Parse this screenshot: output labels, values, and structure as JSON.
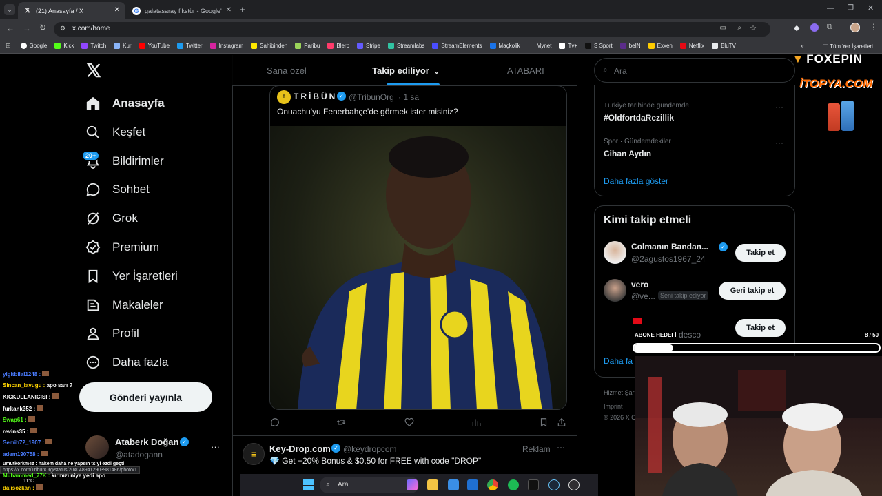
{
  "browser": {
    "tabs": [
      {
        "title": "(21) Anasayfa / X"
      },
      {
        "title": "galatasaray fikstür - Google'da"
      }
    ],
    "url": "x.com/home",
    "bookmarks": [
      "Google",
      "Kick",
      "Twitch",
      "Kur",
      "YouTube",
      "Twitter",
      "Instagram",
      "Sahibinden",
      "Paribu",
      "Blerp",
      "Stripe",
      "Streamlabs",
      "StreamElements",
      "Maçkolik",
      "Mynet",
      "Tv+",
      "S Sport",
      "beIN",
      "Exxen",
      "Netflix",
      "BluTV"
    ],
    "all_bookmarks": "Tüm Yer İşaretleri"
  },
  "nav": {
    "items": [
      {
        "label": "Anasayfa"
      },
      {
        "label": "Keşfet"
      },
      {
        "label": "Bildirimler"
      },
      {
        "label": "Sohbet"
      },
      {
        "label": "Grok"
      },
      {
        "label": "Premium"
      },
      {
        "label": "Yer İşaretleri"
      },
      {
        "label": "Makaleler"
      },
      {
        "label": "Profil"
      },
      {
        "label": "Daha fazla"
      }
    ],
    "notif_badge": "20+",
    "post_button": "Gönderi yayınla",
    "account": {
      "name": "Ataberk Doğan",
      "handle": "@atadogann"
    }
  },
  "feed": {
    "tabs": [
      "Sana özel",
      "Takip ediliyor",
      "ATABARI"
    ],
    "quote": {
      "name": "TRİBÜN",
      "handle": "@TribunOrg",
      "time": "· 1 sa",
      "text": "Onuachu'yu Fenerbahçe'de görmek ister misiniz?"
    },
    "ad": {
      "name": "Key-Drop.com",
      "handle": "@keydropcom",
      "label": "Reklam",
      "text": "💎 Get +20% Bonus & $0.50 for FREE with code \"DROP\""
    }
  },
  "right": {
    "search_placeholder": "Ara",
    "trends": [
      {
        "context": "Türkiye tarihinde gündemde",
        "topic": "#OldfortdaRezillik"
      },
      {
        "context": "Spor · Gündemdekiler",
        "topic": "Cihan Aydın"
      }
    ],
    "show_more": "Daha fazla göster",
    "who_to_follow": {
      "title": "Kimi takip etmeli",
      "users": [
        {
          "name": "Colmanın Bandan...",
          "handle": "@2agustos1967_24",
          "button": "Takip et"
        },
        {
          "name": "vero",
          "handle": "@ve...",
          "badge": "Seni takip ediyor",
          "button": "Geri takip et"
        },
        {
          "name": "",
          "handle": "desco",
          "button": "Takip et"
        }
      ],
      "show_more": "Daha fa"
    },
    "footer": [
      "Hizmet Şar",
      "Imprint",
      "© 2026 X C"
    ]
  },
  "overlay": {
    "sponsors": [
      "FOXEPIN",
      "İTOPYA.COM"
    ],
    "goal_label": "ABONE HEDEFİ",
    "goal_value": "8 / 50",
    "goal_progress": 0.16,
    "status_url": "https://x.com/TribunOrg/status/2040489412903981486/photo/1",
    "weather": "11°C",
    "chat": [
      {
        "user": "yigitbilal1248 :",
        "msg": "",
        "color": "#4a7cff"
      },
      {
        "user": "Sincan_lavugu :",
        "msg": "apo sarı ?",
        "color": "#ffd400"
      },
      {
        "user": "KICKULLANICISI :",
        "msg": "",
        "color": "#ffffff"
      },
      {
        "user": "furkank352 :",
        "msg": "",
        "color": "#ffffff"
      },
      {
        "user": "Swap61 :",
        "msg": "",
        "color": "#53fc18"
      },
      {
        "user": "revins35 :",
        "msg": "",
        "color": "#ffffff"
      },
      {
        "user": "Semih72_1907 :",
        "msg": "",
        "color": "#4a7cff"
      },
      {
        "user": "adem190758 :",
        "msg": "",
        "color": "#4a7cff"
      },
      {
        "user": "umutkorkm4z :",
        "msg": "hakem daha ne yapsın ts yi ezdi geçti",
        "color": "#ffffff"
      },
      {
        "user": "Muhammed_77K :",
        "msg": "kırmızı niye yedi apo",
        "color": "#53fc18"
      },
      {
        "user": "dalisozkan :",
        "msg": "",
        "color": "#ffd400"
      }
    ],
    "taskbar_search": "Ara"
  }
}
